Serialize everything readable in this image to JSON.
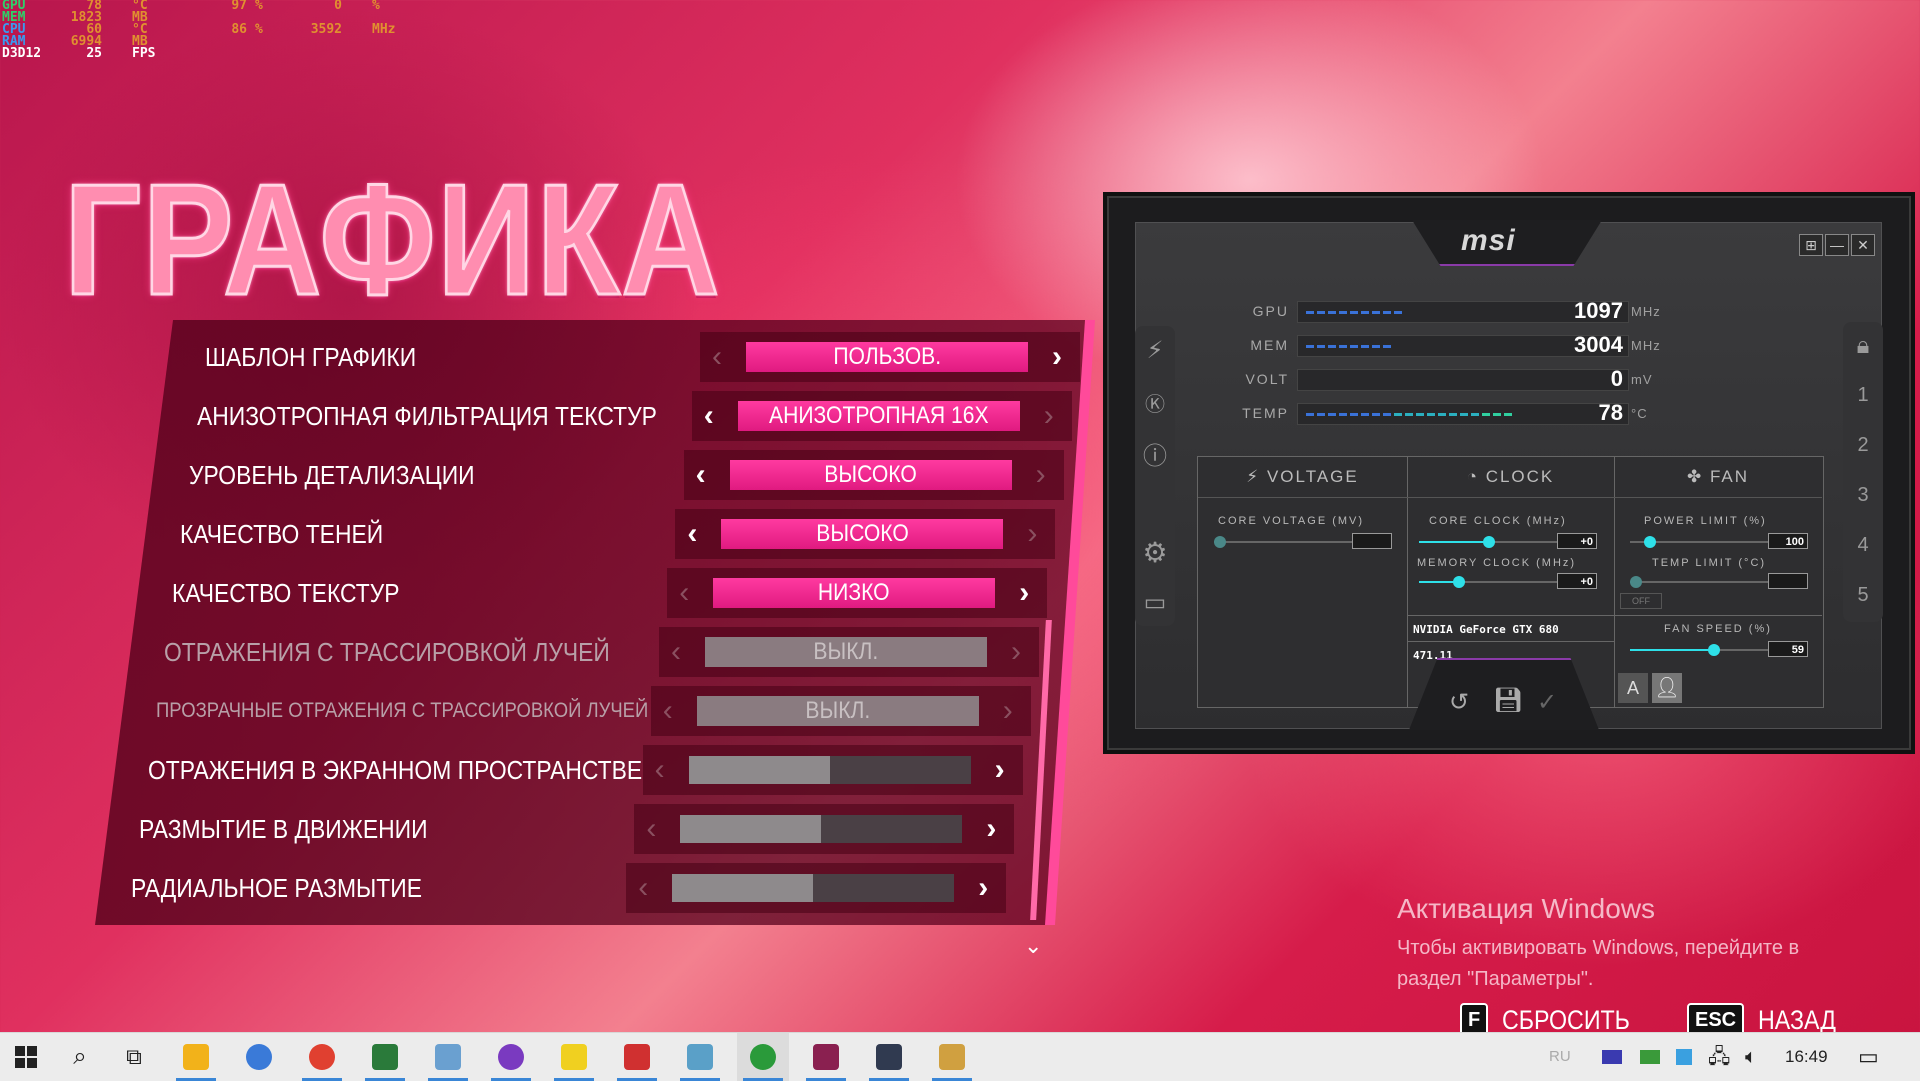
{
  "osd": {
    "rows": [
      {
        "label": "GPU",
        "label_color": "#2fd06a",
        "v1": "78",
        "u1": "°C",
        "v2": "97",
        "u2": "%",
        "v3": "0",
        "u3": "%",
        "value_color": "#e09030"
      },
      {
        "label": "MEM",
        "label_color": "#2fd06a",
        "v1": "1823",
        "u1": "MB",
        "v2": "",
        "u2": "",
        "v3": "",
        "u3": "",
        "value_color": "#e09030"
      },
      {
        "label": "CPU",
        "label_color": "#3a9af0",
        "v1": "60",
        "u1": "°C",
        "v2": "86",
        "u2": "%",
        "v3": "3592",
        "u3": "MHz",
        "value_color": "#e09030"
      },
      {
        "label": "RAM",
        "label_color": "#3a9af0",
        "v1": "6994",
        "u1": "MB",
        "v2": "",
        "u2": "",
        "v3": "",
        "u3": "",
        "value_color": "#e09030"
      },
      {
        "label": "D3D12",
        "label_color": "#ffffff",
        "v1": "25",
        "u1": "FPS",
        "v2": "",
        "u2": "",
        "v3": "",
        "u3": "",
        "value_color": "#ffffff"
      }
    ]
  },
  "page_title": "ГРАФИКА",
  "settings": [
    {
      "label": "ШАБЛОН ГРАФИКИ",
      "type": "value",
      "value": "ПОЛЬЗОВ.",
      "style": "pink",
      "left_active": false,
      "right_active": true,
      "dim": false
    },
    {
      "label": "АНИЗОТРОПНАЯ ФИЛЬТРАЦИЯ ТЕКСТУР",
      "type": "value",
      "value": "АНИЗОТРОПНАЯ 16X",
      "style": "pink",
      "left_active": true,
      "right_active": false,
      "dim": false
    },
    {
      "label": "УРОВЕНЬ ДЕТАЛИЗАЦИИ",
      "type": "value",
      "value": "ВЫСОКО",
      "style": "pink",
      "left_active": true,
      "right_active": false,
      "dim": false
    },
    {
      "label": "КАЧЕСТВО ТЕНЕЙ",
      "type": "value",
      "value": "ВЫСОКО",
      "style": "pink",
      "left_active": true,
      "right_active": false,
      "dim": false
    },
    {
      "label": "КАЧЕСТВО ТЕКСТУР",
      "type": "value",
      "value": "НИЗКО",
      "style": "pink",
      "left_active": false,
      "right_active": true,
      "dim": false
    },
    {
      "label": "ОТРАЖЕНИЯ С ТРАССИРОВКОЙ ЛУЧЕЙ",
      "type": "value",
      "value": "ВЫКЛ.",
      "style": "gray",
      "left_active": false,
      "right_active": false,
      "dim": true
    },
    {
      "label": "ПРОЗРАЧНЫЕ ОТРАЖЕНИЯ С ТРАССИРОВКОЙ ЛУЧЕЙ",
      "type": "value",
      "value": "ВЫКЛ.",
      "style": "gray",
      "left_active": false,
      "right_active": false,
      "dim": true,
      "small": true
    },
    {
      "label": "ОТРАЖЕНИЯ В ЭКРАННОМ ПРОСТРАНСТВЕ",
      "type": "bar",
      "level": 0.5,
      "left_active": false,
      "right_active": true,
      "dim": false
    },
    {
      "label": "РАЗМЫТИЕ В ДВИЖЕНИИ",
      "type": "bar",
      "level": 0.5,
      "left_active": false,
      "right_active": true,
      "dim": false
    },
    {
      "label": "РАДИАЛЬНОЕ РАЗМЫТИЕ",
      "type": "bar",
      "level": 0.5,
      "left_active": false,
      "right_active": true,
      "dim": false
    }
  ],
  "arrows": {
    "left": "‹",
    "right": "›"
  },
  "activation": {
    "title": "Активация Windows",
    "line1": "Чтобы активировать Windows, перейдите в",
    "line2": "раздел \"Параметры\"."
  },
  "hints": {
    "reset_key": "F",
    "reset_label": "СБРОСИТЬ",
    "back_key": "ESC",
    "back_label": "НАЗАД"
  },
  "msi": {
    "logo": "msi",
    "window_buttons": [
      "⊞",
      "—",
      "✕"
    ],
    "stats": [
      {
        "label": "GPU",
        "value": "1097",
        "unit": "MHz",
        "level": 0.36,
        "color": "#3a72d8"
      },
      {
        "label": "MEM",
        "value": "3004",
        "unit": "MHz",
        "level": 0.33,
        "color": "#3a72d8"
      },
      {
        "label": "VOLT",
        "value": "0",
        "unit": "mV",
        "level": 0,
        "color": "#3a72d8"
      },
      {
        "label": "TEMP",
        "value": "78",
        "unit": "°C",
        "level": 0.78,
        "color": "#2bb0c0"
      }
    ],
    "tabs": {
      "voltage": "VOLTAGE",
      "clock": "CLOCK",
      "fan": "FAN"
    },
    "core_voltage_label": "CORE VOLTAGE (MV)",
    "core_clock_label": "CORE CLOCK (MHz)",
    "core_clock_value": "+0",
    "memory_clock_label": "MEMORY CLOCK (MHz)",
    "memory_clock_value": "+0",
    "power_limit_label": "POWER LIMIT (%)",
    "power_limit_value": "100",
    "temp_limit_label": "TEMP LIMIT (°C)",
    "fan_speed_label": "FAN SPEED (%)",
    "fan_speed_value": "59",
    "fan_auto_label": "OFF",
    "gpu_name": "NVIDIA GeForce GTX 680",
    "driver": "471.11",
    "profiles": [
      "1",
      "2",
      "3",
      "4",
      "5"
    ]
  },
  "taskbar": {
    "lang": "RU",
    "time": "16:49",
    "apps": [
      {
        "name": "file-explorer",
        "color": "#f2b21a",
        "active": true
      },
      {
        "name": "qbittorrent",
        "color": "#3a7ad8",
        "active": false
      },
      {
        "name": "chrome",
        "color": "#e04030",
        "active": true
      },
      {
        "name": "excel-like",
        "color": "#2a7a3a",
        "active": true
      },
      {
        "name": "image-viewer",
        "color": "#6aa0d0",
        "active": true
      },
      {
        "name": "tor-browser",
        "color": "#7a3ac0",
        "active": true
      },
      {
        "name": "media-player",
        "color": "#f0d020",
        "active": true
      },
      {
        "name": "game-app",
        "color": "#d03030",
        "active": true
      },
      {
        "name": "app-cube",
        "color": "#5aa0c8",
        "active": true
      },
      {
        "name": "xbox",
        "color": "#2a9a3a",
        "active": true
      },
      {
        "name": "game-icon",
        "color": "#8a2050",
        "active": true
      },
      {
        "name": "msi-afterburner",
        "color": "#303a50",
        "active": true
      },
      {
        "name": "paint-app",
        "color": "#d0a040",
        "active": true
      }
    ]
  }
}
